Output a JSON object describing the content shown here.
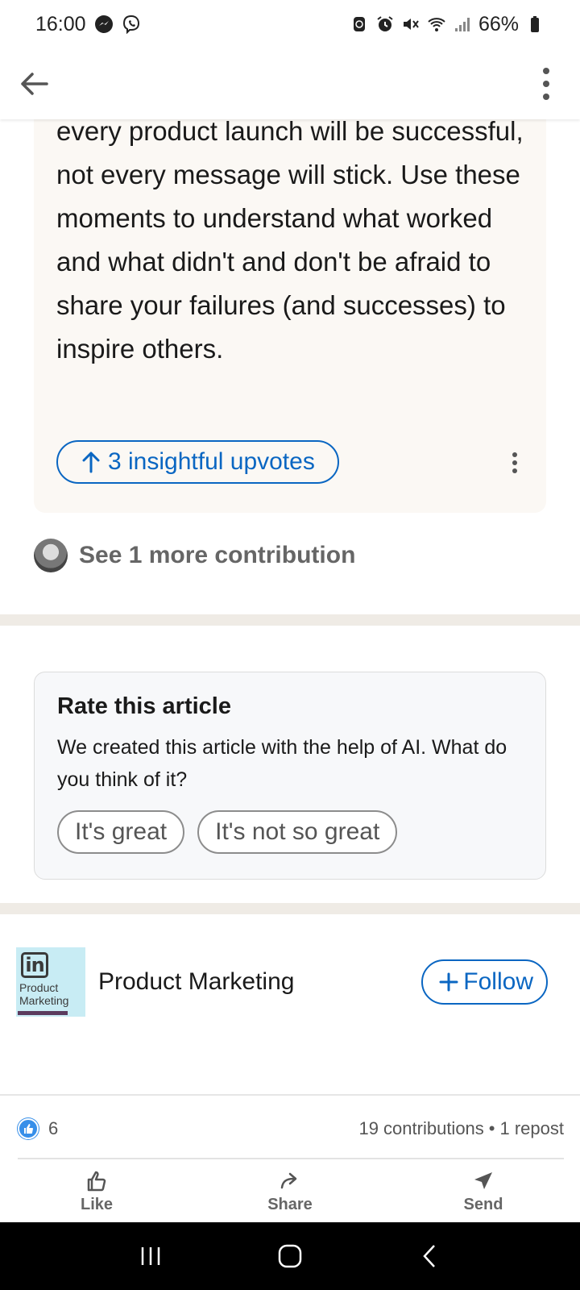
{
  "status_bar": {
    "time": "16:00",
    "battery": "66%"
  },
  "app_bar": {
    "back_icon": "arrow-left-icon",
    "menu_icon": "vertical-dots-icon"
  },
  "contribution": {
    "text": "every product launch will be successful, not every message will stick. Use these moments to understand what worked and what didn't and don't be afraid to share your failures (and successes) to inspire others.",
    "upvote_label": "3 insightful upvotes"
  },
  "more_contributions": {
    "label": "See 1 more contribution"
  },
  "rate": {
    "title": "Rate this article",
    "description": "We created this article with the help of AI. What do you think of it?",
    "options": [
      "It's great",
      "It's not so great"
    ]
  },
  "topic": {
    "logo_mark": "in",
    "logo_text": "Product\nMarketing",
    "name": "Product Marketing",
    "follow_label": "Follow"
  },
  "social": {
    "likes": "6",
    "contributions": "19 contributions",
    "separator": "•",
    "reposts": "1 repost"
  },
  "actions": [
    {
      "label": "Like",
      "icon": "thumbs-up-icon"
    },
    {
      "label": "Share",
      "icon": "share-arrow-icon"
    },
    {
      "label": "Send",
      "icon": "send-icon"
    }
  ],
  "colors": {
    "accent": "#0a66c2",
    "card_bg": "#fbf8f4",
    "divider": "#efebe5"
  }
}
